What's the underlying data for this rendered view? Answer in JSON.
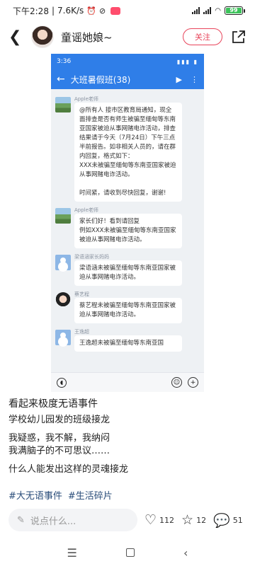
{
  "status_bar": {
    "time": "下午2:28",
    "speed": "7.6K/s",
    "battery": "99"
  },
  "header": {
    "back_icon": "chevron-left-icon",
    "author": "童谣她娘~",
    "follow_label": "关注",
    "share_icon": "share-icon"
  },
  "screenshot": {
    "time": "3:36",
    "group_title": "大班暑假班(38)",
    "messages": [
      {
        "sender": "Apple老师",
        "avatar": "landscape",
        "text": "@所有人 接市区教育局通知，现全面排查是否有师生被骗至缅甸等东南亚国家被迫从事网赌电诈活动，排查结果请于今天（7月24日）下午三点半前报告。如非相关人员的，请在群内回复，格式如下：\nXXX未被骗至缅甸等东南亚国家被迫从事网赌电诈活动。\n\n时间紧，请收到尽快回复，谢谢!"
      },
      {
        "sender": "Apple老师",
        "avatar": "landscape",
        "text": "家长们好！看到请回复\n例如XXX未被骗至缅甸等东南亚国家被迫从事网赌电诈活动。"
      },
      {
        "sender": "梁语涵家长妈妈",
        "avatar": "person",
        "text": "梁语涵未被骗至缅甸等东南亚国家被迫从事网赌电诈活动。"
      },
      {
        "sender": "蔡艺程",
        "avatar": "girl",
        "text": "蔡艺程未被骗至缅甸等东南亚国家被迫从事网赌电诈活动。"
      },
      {
        "sender": "王逸超",
        "avatar": "person",
        "text": "王逸超未被骗至缅甸等东南亚国"
      }
    ]
  },
  "post": {
    "title": "看起来极度无语事件",
    "line1": "学校幼儿园发的班级接龙",
    "line2": "我疑惑，我不解，我纳闷",
    "line3": "我满脑子的不可思议……",
    "line4": "什么人能发出这样的灵魂接龙",
    "tags": [
      "#大无语事件",
      "#生活碎片"
    ]
  },
  "actions": {
    "comment_placeholder": "说点什么...",
    "likes": "112",
    "stars": "12",
    "comments": "51"
  }
}
